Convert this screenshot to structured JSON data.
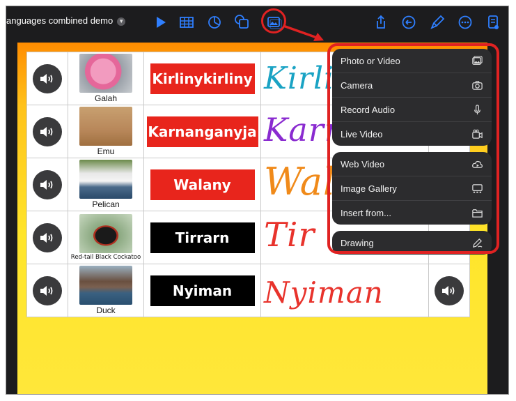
{
  "toolbar": {
    "doc_title": "anguages combined demo",
    "icons": [
      "play-icon",
      "table-icon",
      "chart-icon",
      "shapes-icon",
      "media-icon",
      "share-icon",
      "undo-icon",
      "format-brush-icon",
      "more-icon",
      "document-icon"
    ]
  },
  "rows": [
    {
      "caption": "Galah",
      "word": "Kirlinykirliny",
      "word_bg": "#e8251c",
      "handwriting": "Kirlin",
      "hand_color": "#1aa3c4"
    },
    {
      "caption": "Emu",
      "word": "Karnanganyja",
      "word_bg": "#e8251c",
      "handwriting": "Karn",
      "hand_color": "#8a2bd0"
    },
    {
      "caption": "Pelican",
      "word": "Walany",
      "word_bg": "#e8251c",
      "handwriting": "Wal",
      "hand_color": "#f08a1a"
    },
    {
      "caption": "Red-tail Black Cockatoo",
      "word": "Tirrarn",
      "word_bg": "#000000",
      "handwriting": "Tir",
      "hand_color": "#e8332c"
    },
    {
      "caption": "Duck",
      "word": "Nyiman",
      "word_bg": "#000000",
      "handwriting": "Nyiman",
      "hand_color": "#e8332c"
    }
  ],
  "menu": {
    "groups": [
      [
        {
          "label": "Photo or Video",
          "icon": "photo-icon"
        },
        {
          "label": "Camera",
          "icon": "camera-icon"
        },
        {
          "label": "Record Audio",
          "icon": "microphone-icon"
        },
        {
          "label": "Live Video",
          "icon": "live-video-icon"
        }
      ],
      [
        {
          "label": "Web Video",
          "icon": "cloud-play-icon"
        },
        {
          "label": "Image Gallery",
          "icon": "gallery-icon"
        },
        {
          "label": "Insert from...",
          "icon": "folder-icon"
        }
      ],
      [
        {
          "label": "Drawing",
          "icon": "pencil-icon"
        }
      ]
    ]
  },
  "colors": {
    "accent": "#2f7fff",
    "highlight": "#e02222",
    "menu_bg": "#2c2c2e",
    "toolbar_bg": "#1c1c1e"
  }
}
